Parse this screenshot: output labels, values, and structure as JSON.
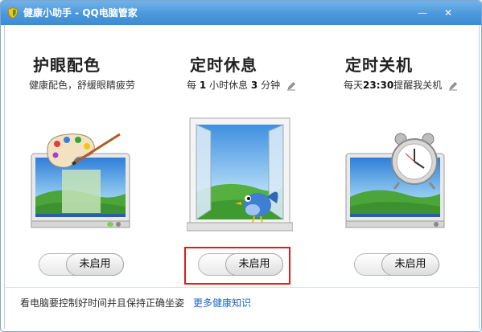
{
  "window": {
    "title": "健康小助手 - QQ电脑管家",
    "minimize_glyph": "—",
    "close_glyph": "✕"
  },
  "columns": [
    {
      "title": "护眼配色",
      "desc": "健康配色，舒缓眼睛疲劳",
      "toggle_label": "未启用",
      "illustration": "monitor-with-paint-palette-icon"
    },
    {
      "title": "定时休息",
      "desc_prefix": "每",
      "desc_value1": "1",
      "desc_middle": "小时休息",
      "desc_value2": "3",
      "desc_suffix": "分钟",
      "toggle_label": "未启用",
      "illustration": "open-window-with-bird-icon"
    },
    {
      "title": "定时关机",
      "desc_prefix": "每天",
      "desc_value": "23:30",
      "desc_suffix": "提醒我关机",
      "toggle_label": "未启用",
      "illustration": "monitor-with-alarm-clock-icon"
    }
  ],
  "footer": {
    "text": "看电脑要控制好时间并且保持正确坐姿",
    "link": "更多健康知识"
  },
  "colors": {
    "titlebar": "#4c98dd",
    "link": "#1a66c6",
    "highlight": "#e11a1a"
  }
}
